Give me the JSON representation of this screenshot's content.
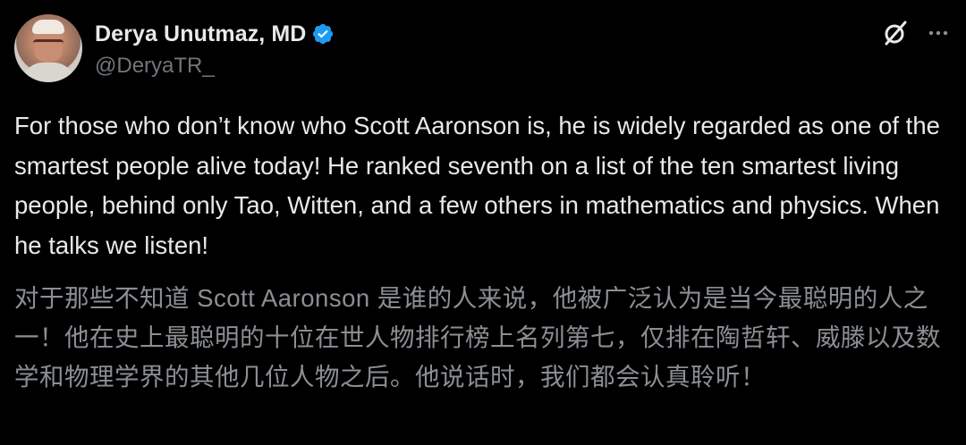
{
  "author": {
    "display_name": "Derya Unutmaz, MD",
    "handle": "@DeryaTR_",
    "verified": true,
    "avatar": "profile-photo"
  },
  "icons": {
    "verified": "verified-badge-icon",
    "grok": "grok-icon",
    "more": "more-options-icon"
  },
  "colors": {
    "background": "#000000",
    "primary_text": "#e7e9ea",
    "secondary_text": "#71767b",
    "verified_blue": "#1d9bf0"
  },
  "tweet": {
    "text_en": "For those who don’t know who Scott Aaronson is, he is widely regarded as one of the smartest people alive today! He ranked seventh on a list of the ten smartest living people, behind only Tao, Witten, and a few others in mathematics and physics. When he talks we listen!",
    "text_zh": "对于那些不知道 Scott Aaronson 是谁的人来说，他被广泛认为是当今最聪明的人之一！他在史上最聪明的十位在世人物排行榜上名列第七，仅排在陶哲轩、威滕以及数学和物理学界的其他几位人物之后。他说话时，我们都会认真聆听！"
  }
}
